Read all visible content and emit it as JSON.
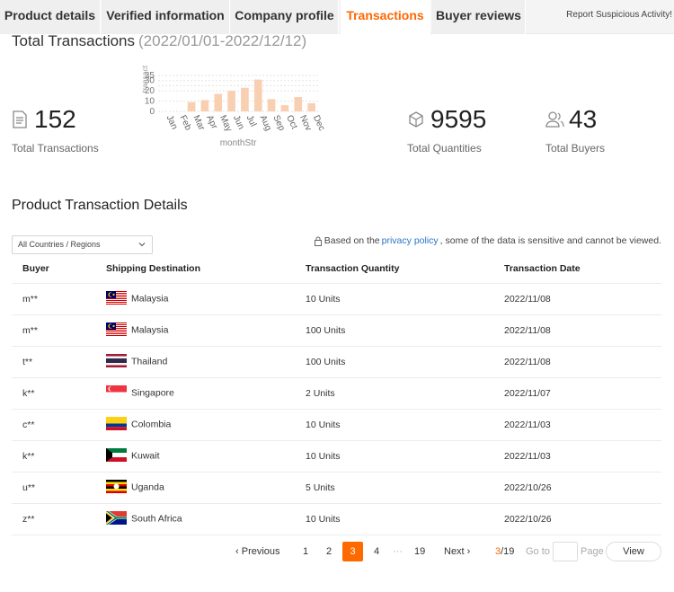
{
  "tabs": [
    {
      "label": "Product details",
      "active": false
    },
    {
      "label": "Verified information",
      "active": false
    },
    {
      "label": "Company profile",
      "active": false
    },
    {
      "label": "Transactions",
      "active": true
    },
    {
      "label": "Buyer reviews",
      "active": false
    }
  ],
  "report_link": "Report Suspicious Activity!",
  "summary": {
    "title": "Total Transactions",
    "range": "(2022/01/01-2022/12/12)",
    "transactions": {
      "value": "152",
      "label": "Total Transactions"
    },
    "quantities": {
      "value": "9595",
      "label": "Total Quantities"
    },
    "buyers": {
      "value": "43",
      "label": "Total Buyers"
    }
  },
  "chart_data": {
    "type": "bar",
    "categories": [
      "Jan",
      "Feb",
      "Mar",
      "Apr",
      "May",
      "Jun",
      "Jul",
      "Aug",
      "Sep",
      "Oct",
      "Nov",
      "Dec"
    ],
    "values": [
      0,
      0,
      9,
      11,
      17,
      20,
      23,
      31,
      12,
      6,
      14,
      8
    ],
    "xlabel": "monthStr",
    "ylabel": "transact",
    "yticks": [
      0,
      10,
      20,
      25,
      30,
      35
    ],
    "ylim": [
      0,
      35
    ],
    "grid": true,
    "bar_color": "#f9cfb2"
  },
  "details": {
    "title": "Product Transaction Details",
    "filter_selected": "All Countries / Regions",
    "privacy_prefix": "Based on the ",
    "privacy_link": "privacy policy",
    "privacy_suffix": ", some of the data is sensitive and cannot be viewed.",
    "columns": [
      "Buyer",
      "Shipping Destination",
      "Transaction Quantity",
      "Transaction Date"
    ],
    "rows": [
      {
        "buyer": "m**",
        "country": "Malaysia",
        "flag": "my",
        "qty": "10 Units",
        "date": "2022/11/08"
      },
      {
        "buyer": "m**",
        "country": "Malaysia",
        "flag": "my",
        "qty": "100 Units",
        "date": "2022/11/08"
      },
      {
        "buyer": "t**",
        "country": "Thailand",
        "flag": "th",
        "qty": "100 Units",
        "date": "2022/11/08"
      },
      {
        "buyer": "k**",
        "country": "Singapore",
        "flag": "sg",
        "qty": "2 Units",
        "date": "2022/11/07"
      },
      {
        "buyer": "c**",
        "country": "Colombia",
        "flag": "co",
        "qty": "10 Units",
        "date": "2022/11/03"
      },
      {
        "buyer": "k**",
        "country": "Kuwait",
        "flag": "kw",
        "qty": "10 Units",
        "date": "2022/11/03"
      },
      {
        "buyer": "u**",
        "country": "Uganda",
        "flag": "ug",
        "qty": "5 Units",
        "date": "2022/10/26"
      },
      {
        "buyer": "z**",
        "country": "South Africa",
        "flag": "za",
        "qty": "10 Units",
        "date": "2022/10/26"
      }
    ]
  },
  "pagination": {
    "prev": "Previous",
    "pages": [
      "1",
      "2",
      "3",
      "4",
      "···",
      "19"
    ],
    "current": "3",
    "next": "Next",
    "current_of": "3",
    "total": "/19",
    "goto_label": "Go to",
    "page_label": "Page",
    "view_label": "View"
  },
  "colors": {
    "accent": "#ff6600",
    "link": "#2a74c9"
  }
}
